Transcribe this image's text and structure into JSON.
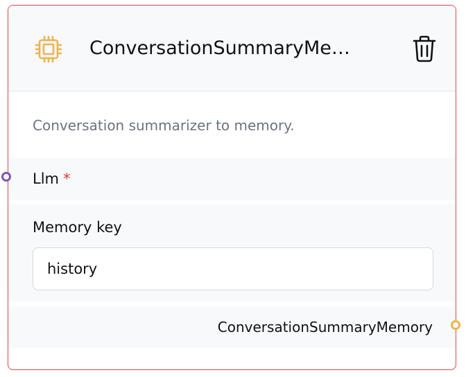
{
  "node": {
    "title": "ConversationSummaryMemory",
    "description": "Conversation summarizer to memory.",
    "icon": "cpu-chip-icon",
    "delete_icon": "trash-icon",
    "border_color": "#e04646",
    "icon_color": "#f2b24a"
  },
  "inputs": {
    "llm": {
      "label": "Llm",
      "required_marker": "*",
      "handle_color": "#7a55c8"
    },
    "memory_key": {
      "label": "Memory key",
      "value": "history"
    }
  },
  "output": {
    "label": "ConversationSummaryMemory",
    "handle_color": "#f2b24a"
  }
}
